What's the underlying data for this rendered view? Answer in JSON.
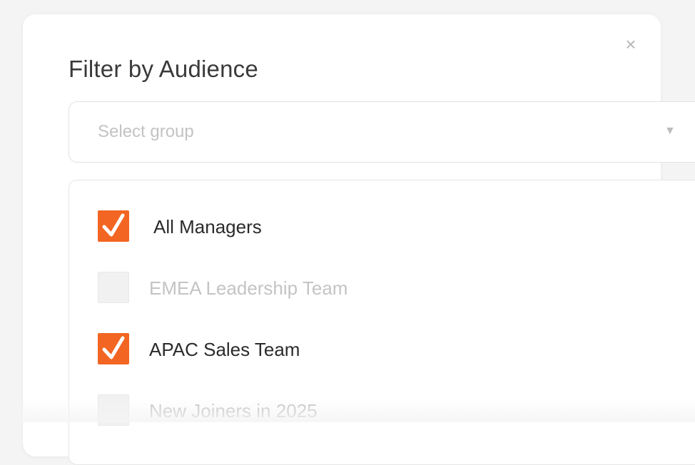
{
  "dialog": {
    "title": "Filter by Audience",
    "close_icon": "close-icon"
  },
  "select": {
    "placeholder": "Select group",
    "caret_icon": "caret-down-icon"
  },
  "options": [
    {
      "label": "All Managers",
      "checked": true
    },
    {
      "label": "EMEA Leadership Team",
      "checked": false
    },
    {
      "label": "APAC Sales Team",
      "checked": true
    },
    {
      "label": "New Joiners in 2025",
      "checked": false
    }
  ],
  "colors": {
    "accent": "#f26522",
    "unchecked_box": "#f1f1f1",
    "muted_text": "#c4c4c4"
  }
}
